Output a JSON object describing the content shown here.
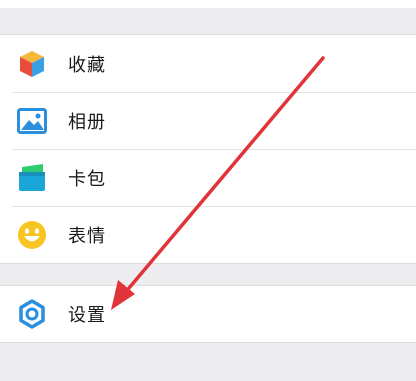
{
  "menu": {
    "items": [
      {
        "label": "收藏",
        "icon": "favorites-cube-icon"
      },
      {
        "label": "相册",
        "icon": "album-picture-icon"
      },
      {
        "label": "卡包",
        "icon": "card-wallet-icon"
      },
      {
        "label": "表情",
        "icon": "sticker-smiley-icon"
      }
    ],
    "settings": {
      "label": "设置",
      "icon": "settings-gear-icon"
    }
  },
  "annotation": {
    "arrow_color": "#e1343a"
  }
}
